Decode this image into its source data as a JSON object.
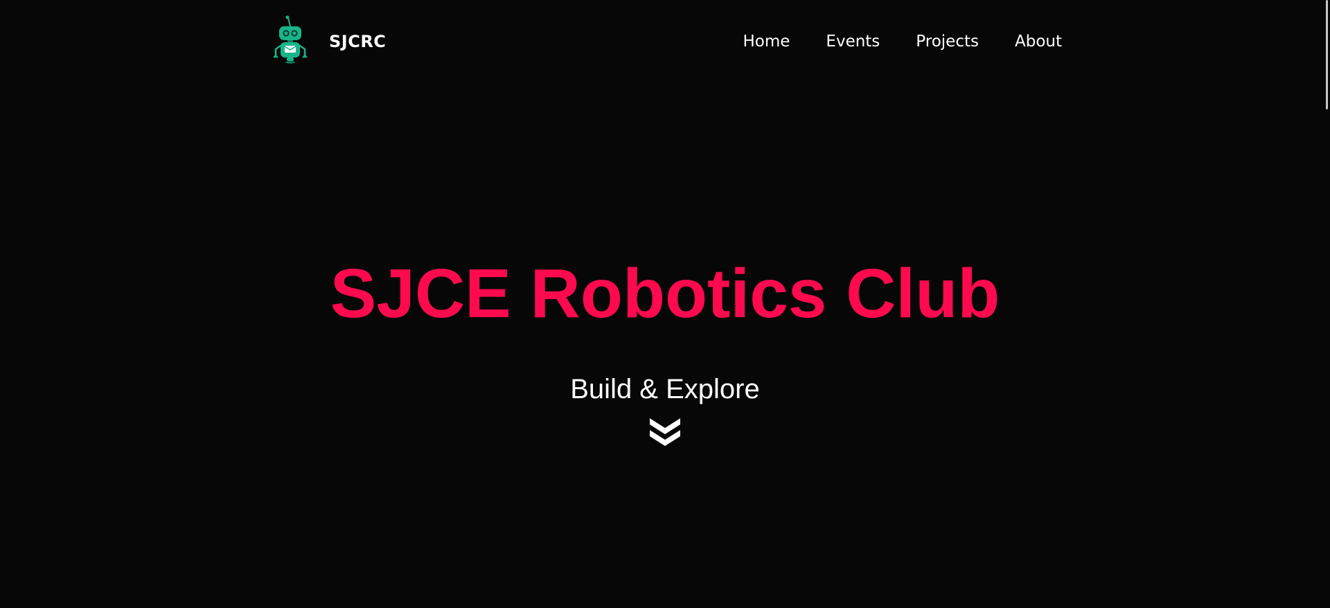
{
  "header": {
    "brand": "SJCRC",
    "nav": [
      {
        "label": "Home"
      },
      {
        "label": "Events"
      },
      {
        "label": "Projects"
      },
      {
        "label": "About"
      }
    ]
  },
  "hero": {
    "title": "SJCE Robotics Club",
    "subtitle": "Build & Explore",
    "scroll_icon": "double-chevron-down-icon"
  },
  "logo_icon": "robot-icon",
  "colors": {
    "background": "#070707",
    "accent": "#ff0a4e",
    "logo": "#19b48a",
    "text": "#ffffff"
  }
}
